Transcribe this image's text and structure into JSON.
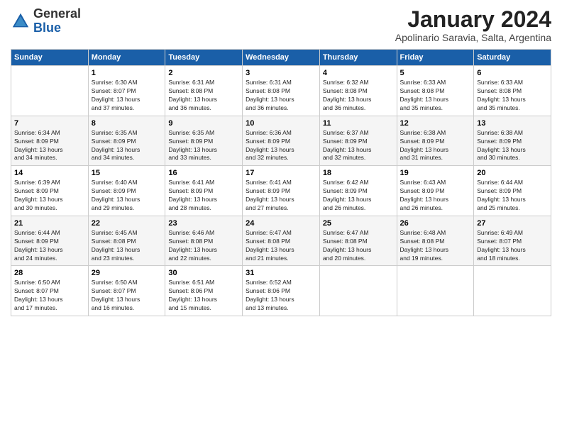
{
  "header": {
    "logo_general": "General",
    "logo_blue": "Blue",
    "month_year": "January 2024",
    "location": "Apolinario Saravia, Salta, Argentina"
  },
  "days_of_week": [
    "Sunday",
    "Monday",
    "Tuesday",
    "Wednesday",
    "Thursday",
    "Friday",
    "Saturday"
  ],
  "weeks": [
    [
      {
        "num": "",
        "info": ""
      },
      {
        "num": "1",
        "info": "Sunrise: 6:30 AM\nSunset: 8:07 PM\nDaylight: 13 hours\nand 37 minutes."
      },
      {
        "num": "2",
        "info": "Sunrise: 6:31 AM\nSunset: 8:08 PM\nDaylight: 13 hours\nand 36 minutes."
      },
      {
        "num": "3",
        "info": "Sunrise: 6:31 AM\nSunset: 8:08 PM\nDaylight: 13 hours\nand 36 minutes."
      },
      {
        "num": "4",
        "info": "Sunrise: 6:32 AM\nSunset: 8:08 PM\nDaylight: 13 hours\nand 36 minutes."
      },
      {
        "num": "5",
        "info": "Sunrise: 6:33 AM\nSunset: 8:08 PM\nDaylight: 13 hours\nand 35 minutes."
      },
      {
        "num": "6",
        "info": "Sunrise: 6:33 AM\nSunset: 8:08 PM\nDaylight: 13 hours\nand 35 minutes."
      }
    ],
    [
      {
        "num": "7",
        "info": "Sunrise: 6:34 AM\nSunset: 8:09 PM\nDaylight: 13 hours\nand 34 minutes."
      },
      {
        "num": "8",
        "info": "Sunrise: 6:35 AM\nSunset: 8:09 PM\nDaylight: 13 hours\nand 34 minutes."
      },
      {
        "num": "9",
        "info": "Sunrise: 6:35 AM\nSunset: 8:09 PM\nDaylight: 13 hours\nand 33 minutes."
      },
      {
        "num": "10",
        "info": "Sunrise: 6:36 AM\nSunset: 8:09 PM\nDaylight: 13 hours\nand 32 minutes."
      },
      {
        "num": "11",
        "info": "Sunrise: 6:37 AM\nSunset: 8:09 PM\nDaylight: 13 hours\nand 32 minutes."
      },
      {
        "num": "12",
        "info": "Sunrise: 6:38 AM\nSunset: 8:09 PM\nDaylight: 13 hours\nand 31 minutes."
      },
      {
        "num": "13",
        "info": "Sunrise: 6:38 AM\nSunset: 8:09 PM\nDaylight: 13 hours\nand 30 minutes."
      }
    ],
    [
      {
        "num": "14",
        "info": "Sunrise: 6:39 AM\nSunset: 8:09 PM\nDaylight: 13 hours\nand 30 minutes."
      },
      {
        "num": "15",
        "info": "Sunrise: 6:40 AM\nSunset: 8:09 PM\nDaylight: 13 hours\nand 29 minutes."
      },
      {
        "num": "16",
        "info": "Sunrise: 6:41 AM\nSunset: 8:09 PM\nDaylight: 13 hours\nand 28 minutes."
      },
      {
        "num": "17",
        "info": "Sunrise: 6:41 AM\nSunset: 8:09 PM\nDaylight: 13 hours\nand 27 minutes."
      },
      {
        "num": "18",
        "info": "Sunrise: 6:42 AM\nSunset: 8:09 PM\nDaylight: 13 hours\nand 26 minutes."
      },
      {
        "num": "19",
        "info": "Sunrise: 6:43 AM\nSunset: 8:09 PM\nDaylight: 13 hours\nand 26 minutes."
      },
      {
        "num": "20",
        "info": "Sunrise: 6:44 AM\nSunset: 8:09 PM\nDaylight: 13 hours\nand 25 minutes."
      }
    ],
    [
      {
        "num": "21",
        "info": "Sunrise: 6:44 AM\nSunset: 8:09 PM\nDaylight: 13 hours\nand 24 minutes."
      },
      {
        "num": "22",
        "info": "Sunrise: 6:45 AM\nSunset: 8:08 PM\nDaylight: 13 hours\nand 23 minutes."
      },
      {
        "num": "23",
        "info": "Sunrise: 6:46 AM\nSunset: 8:08 PM\nDaylight: 13 hours\nand 22 minutes."
      },
      {
        "num": "24",
        "info": "Sunrise: 6:47 AM\nSunset: 8:08 PM\nDaylight: 13 hours\nand 21 minutes."
      },
      {
        "num": "25",
        "info": "Sunrise: 6:47 AM\nSunset: 8:08 PM\nDaylight: 13 hours\nand 20 minutes."
      },
      {
        "num": "26",
        "info": "Sunrise: 6:48 AM\nSunset: 8:08 PM\nDaylight: 13 hours\nand 19 minutes."
      },
      {
        "num": "27",
        "info": "Sunrise: 6:49 AM\nSunset: 8:07 PM\nDaylight: 13 hours\nand 18 minutes."
      }
    ],
    [
      {
        "num": "28",
        "info": "Sunrise: 6:50 AM\nSunset: 8:07 PM\nDaylight: 13 hours\nand 17 minutes."
      },
      {
        "num": "29",
        "info": "Sunrise: 6:50 AM\nSunset: 8:07 PM\nDaylight: 13 hours\nand 16 minutes."
      },
      {
        "num": "30",
        "info": "Sunrise: 6:51 AM\nSunset: 8:06 PM\nDaylight: 13 hours\nand 15 minutes."
      },
      {
        "num": "31",
        "info": "Sunrise: 6:52 AM\nSunset: 8:06 PM\nDaylight: 13 hours\nand 13 minutes."
      },
      {
        "num": "",
        "info": ""
      },
      {
        "num": "",
        "info": ""
      },
      {
        "num": "",
        "info": ""
      }
    ]
  ]
}
